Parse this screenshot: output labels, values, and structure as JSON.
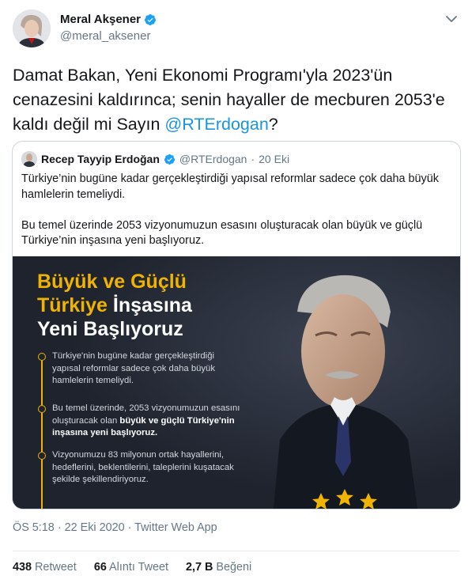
{
  "author": {
    "name": "Meral Akşener",
    "handle": "@meral_aksener"
  },
  "tweet": {
    "text_before": "Damat Bakan, Yeni Ekonomi Programı'yla 2023'ün cenazesini kaldırınca; senin hayaller de mecburen 2053'e kaldı değil mi Sayın ",
    "mention": "@RTErdogan",
    "text_after": "?"
  },
  "quoted": {
    "name": "Recep Tayyip Erdoğan",
    "handle": "@RTErdogan",
    "separator": "·",
    "date": "20 Eki",
    "paragraph1": "Türkiye’nin bugüne kadar gerçekleştirdiği yapısal reformlar sadece çok daha büyük hamlelerin temeliydi.",
    "paragraph2": "Bu temel üzerinde 2053 vizyonumuzun esasını oluşturacak olan büyük ve güçlü Türkiye’nin inşasına yeni başlıyoruz.",
    "media": {
      "headline_line1": "Büyük ve Güçlü",
      "headline_line2_gold": "Türkiye",
      "headline_line2_white": "İnşasına",
      "headline_line3": "Yeni Başlıyoruz",
      "item1": "Türkiye'nin bugüne kadar gerçekleştirdiği yapısal reformlar sadece çok daha büyük hamlelerin temeliydi.",
      "item2_plain": "Bu temel üzerinde, 2053 vizyonumuzun esasını oluşturacak olan",
      "item2_bold": "büyük ve güçlü Türkiye'nin inşasına yeni başlıyoruz.",
      "item3": "Vizyonumuzu 83 milyonun ortak hayallerini, hedeflerini, beklentilerini, taleplerini kuşatacak şekilde şekillendiriyoruz.",
      "accent_color": "#f0b400",
      "background_color": "#242a36"
    }
  },
  "meta": {
    "time": "ÖS 5:18",
    "separator": "·",
    "date": "22 Eki 2020",
    "source": "Twitter Web App"
  },
  "stats": {
    "retweets": "438",
    "retweets_label": "Retweet",
    "quotes": "66",
    "quotes_label": "Alıntı Tweet",
    "likes": "2,7 B",
    "likes_label": "Beğeni"
  },
  "colors": {
    "link": "#1b95e0",
    "verified": "#1da1f2",
    "secondary_text": "#657786"
  }
}
